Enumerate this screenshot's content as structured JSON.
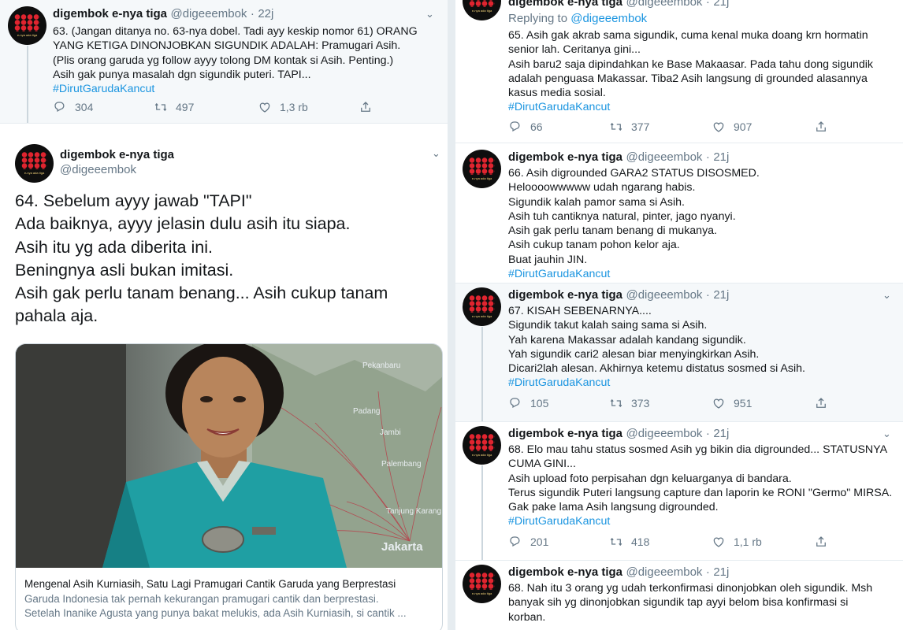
{
  "user": {
    "name": "digembok e-nya tiga",
    "handle": "@digeeembok",
    "avatar_caption": "e-nya ada tiga"
  },
  "left": {
    "tweet63": {
      "time": "22j",
      "lines": [
        "63. (Jangan ditanya no. 63-nya dobel. Tadi ayy keskip nomor 61) ORANG",
        "YANG KETIGA DINONJOBKAN SIGUNDIK ADALAH: Pramugari Asih.",
        "(Plis orang garuda yg follow ayyy tolong DM kontak si Asih. Penting.)",
        "Asih gak punya masalah dgn sigundik puteri. TAPI..."
      ],
      "hashtag": "#DirutGarudaKancut",
      "replies": "304",
      "retweets": "497",
      "likes": "1,3 rb"
    },
    "tweet64": {
      "lines": [
        "64. Sebelum ayyy jawab \"TAPI\"",
        "Ada baiknya, ayyy jelasin dulu asih itu siapa.",
        "Asih itu yg ada diberita ini.",
        "Beningnya asli bukan imitasi.",
        "Asih gak perlu tanam benang... Asih cukup tanam",
        "pahala aja."
      ],
      "card": {
        "title": "Mengenal Asih Kurniasih, Satu Lagi Pramugari Cantik Garuda yang Berprestasi",
        "desc1": "Garuda Indonesia tak pernah kekurangan pramugari cantik dan berprestasi.",
        "desc2": "Setelah Inanike Agusta yang punya bakat melukis, ada Asih Kurniasih, si cantik ...",
        "map_labels": [
          "Pekanbaru",
          "Padang",
          "Jambi",
          "Palembang",
          "Tanjung Karang",
          "Jakarta"
        ]
      }
    }
  },
  "right": {
    "tweet65": {
      "time": "21j",
      "replying_prefix": "Replying to",
      "replying_to": "@digeeembok",
      "lines": [
        "65. Asih gak akrab sama sigundik, cuma kenal muka doang krn hormatin",
        "senior lah. Ceritanya gini...",
        "Asih baru2 saja dipindahkan ke Base Makaasar. Pada tahu dong sigundik",
        "adalah penguasa Makassar. Tiba2 Asih langsung di grounded alasannya",
        "kasus media sosial."
      ],
      "hashtag": "#DirutGarudaKancut",
      "replies": "66",
      "retweets": "377",
      "likes": "907"
    },
    "tweet66": {
      "time": "21j",
      "lines": [
        "66. Asih digrounded GARA2 STATUS DISOSMED.",
        "Heloooowwwww udah ngarang habis.",
        "Sigundik kalah pamor sama si Asih.",
        "Asih tuh cantiknya natural, pinter, jago nyanyi.",
        "Asih gak perlu tanam benang di mukanya.",
        "Asih cukup tanam pohon kelor aja.",
        "Buat jauhin JIN."
      ],
      "hashtag": "#DirutGarudaKancut"
    },
    "tweet67": {
      "time": "21j",
      "lines": [
        "67. KISAH SEBENARNYA....",
        "Sigundik takut kalah saing sama si Asih.",
        "Yah karena Makassar adalah kandang sigundik.",
        "Yah sigundik cari2 alesan biar menyingkirkan Asih.",
        "Dicari2lah alesan. Akhirnya ketemu distatus sosmed si Asih."
      ],
      "hashtag": "#DirutGarudaKancut",
      "replies": "105",
      "retweets": "373",
      "likes": "951"
    },
    "tweet68a": {
      "time": "21j",
      "lines": [
        "68. Elo mau tahu status sosmed Asih yg bikin dia digrounded... STATUSNYA",
        "CUMA GINI...",
        "Asih upload foto perpisahan dgn keluarganya di bandara.",
        "Terus sigundik Puteri langsung capture dan laporin ke RONI \"Germo\" MIRSA.",
        "Gak pake lama Asih langsung digrounded."
      ],
      "hashtag": "#DirutGarudaKancut",
      "replies": "201",
      "retweets": "418",
      "likes": "1,1 rb"
    },
    "tweet68b": {
      "time": "21j",
      "lines": [
        "68. Nah itu 3 orang yg udah terkonfirmasi dinonjobkan oleh sigundik. Msh",
        "banyak sih yg dinonjobkan sigundik tap ayyi belom bisa konfirmasi si",
        "korban."
      ]
    }
  },
  "colors": {
    "link": "#1b95e0",
    "muted": "#657786",
    "border": "#e6ecf0"
  }
}
